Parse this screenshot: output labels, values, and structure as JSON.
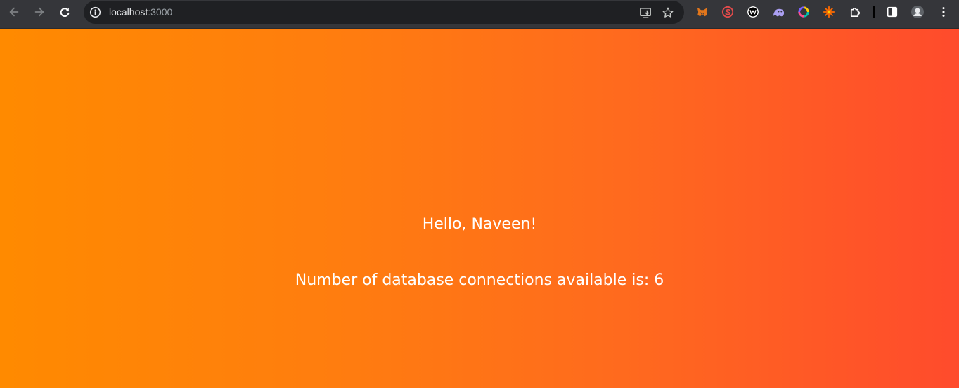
{
  "browser": {
    "url_host": "localhost",
    "url_port": ":3000",
    "icons": {
      "back": "arrow-left-icon",
      "forward": "arrow-right-icon",
      "reload": "reload-icon",
      "site_info": "info-icon",
      "install": "install-app-icon",
      "bookmark": "star-icon",
      "extensions": "puzzle-icon",
      "side_panel": "side-panel-icon",
      "profile": "avatar",
      "menu": "kebab-menu-icon"
    },
    "extensions": [
      {
        "name": "metamask-fox-icon",
        "color": "#e2761b"
      },
      {
        "name": "s-shield-icon",
        "color": "#e34b4b"
      },
      {
        "name": "w-circle-icon",
        "color": "#ffffff"
      },
      {
        "name": "ghost-icon",
        "color": "#ab9ff2"
      },
      {
        "name": "color-ring-icon",
        "color": "#7b61ff"
      },
      {
        "name": "spark-icon",
        "color": "#ff6a00"
      }
    ]
  },
  "page": {
    "background_start": "#ff8a00",
    "background_end": "#ff4b2c",
    "greeting": "Hello, Naveen!",
    "connections_text": "Number of database connections available is: 6"
  }
}
